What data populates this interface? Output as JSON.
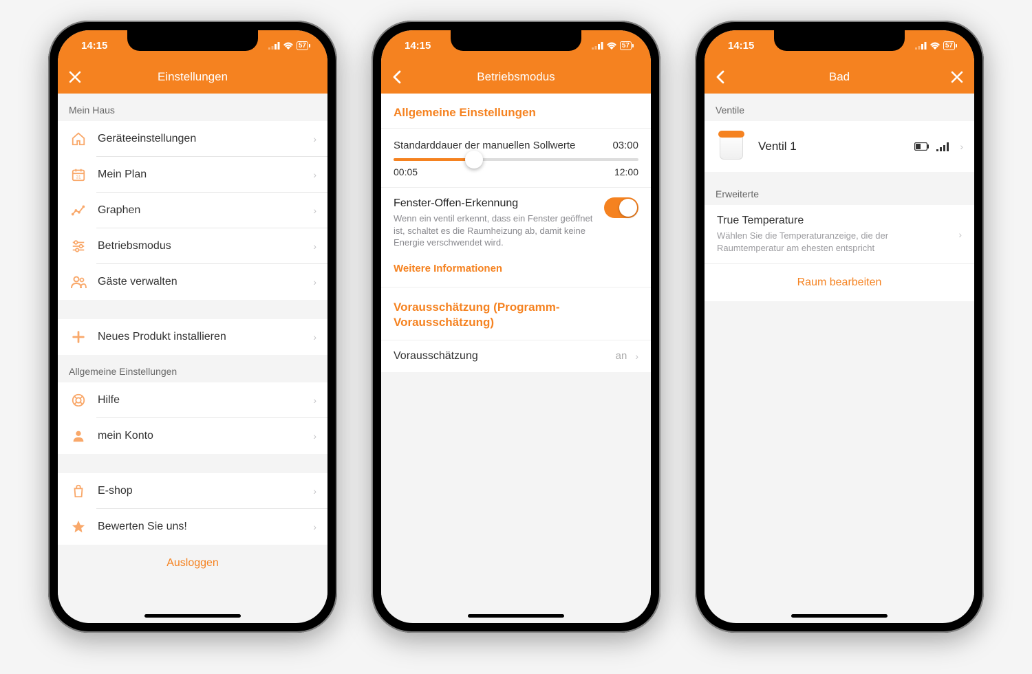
{
  "status": {
    "time": "14:15",
    "battery": "57"
  },
  "phone1": {
    "title": "Einstellungen",
    "section_myhouse": "Mein Haus",
    "items_myhouse": {
      "device_settings": "Geräteeinstellungen",
      "my_plan": "Mein Plan",
      "graphs": "Graphen",
      "mode": "Betriebsmodus",
      "guests": "Gäste verwalten"
    },
    "new_product": "Neues Produkt installieren",
    "section_general": "Allgemeine Einstellungen",
    "help": "Hilfe",
    "account": "mein Konto",
    "eshop": "E-shop",
    "rate": "Bewerten Sie uns!",
    "logout": "Ausloggen"
  },
  "phone2": {
    "title": "Betriebsmodus",
    "section_general": "Allgemeine Einstellungen",
    "slider_label": "Standarddauer der manuellen Sollwerte",
    "slider_value": "03:00",
    "slider_min": "00:05",
    "slider_max": "12:00",
    "window_title": "Fenster-Offen-Erkennung",
    "window_desc": "Wenn ein ventil erkennt, dass ein Fenster geöffnet ist, schaltet es die Raumheizung ab, damit keine Energie verschwendet wird.",
    "more_info": "Weitere Informationen",
    "forecast_title": "Vorausschätzung (Programm-Vorausschätzung)",
    "forecast_label": "Vorausschätzung",
    "forecast_value": "an"
  },
  "phone3": {
    "title": "Bad",
    "section_valves": "Ventile",
    "valve_name": "Ventil 1",
    "section_advanced": "Erweiterte",
    "tt_title": "True Temperature",
    "tt_desc": "Wählen Sie die Temperaturanzeige, die der Raumtemperatur am ehesten entspricht",
    "edit_room": "Raum bearbeiten"
  }
}
